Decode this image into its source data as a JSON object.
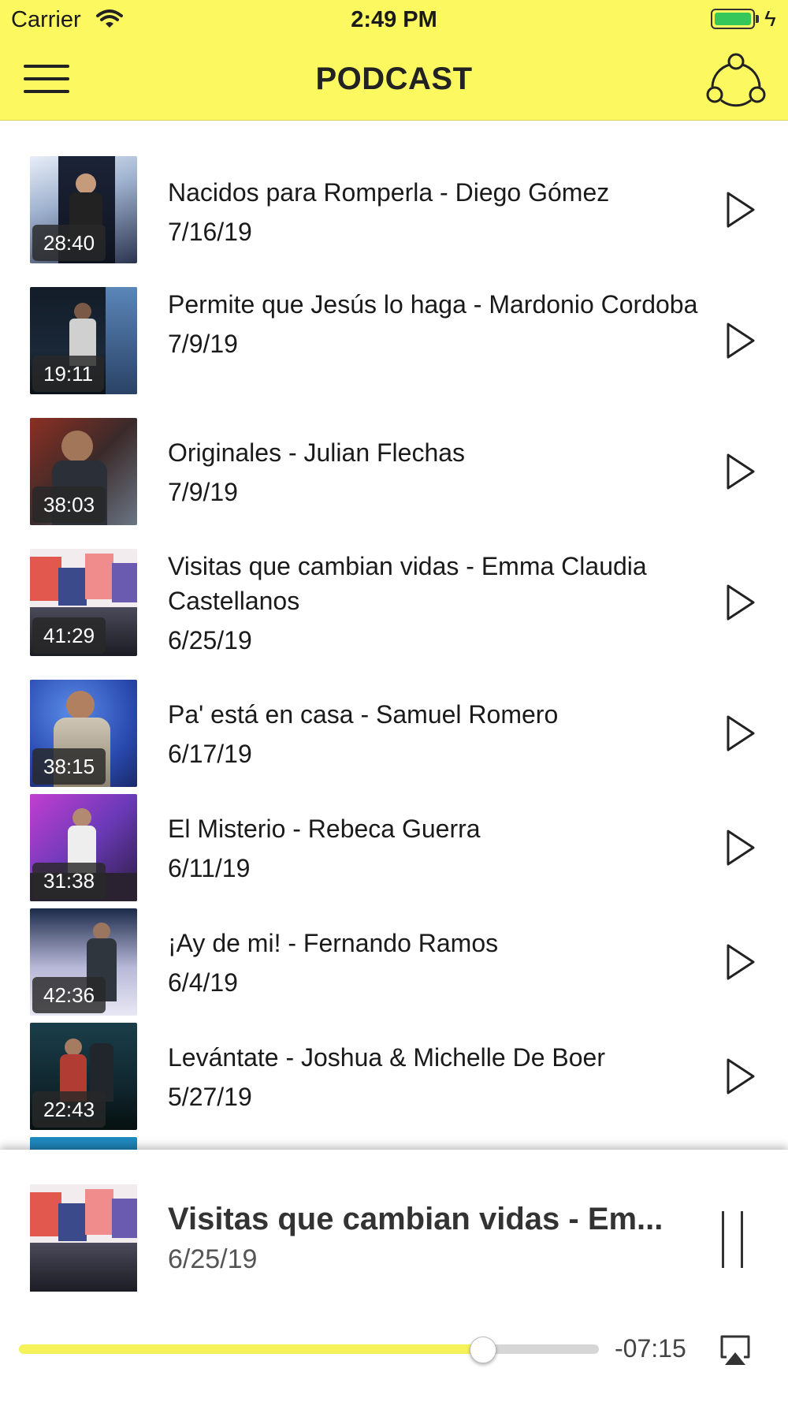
{
  "status": {
    "carrier": "Carrier",
    "time": "2:49 PM"
  },
  "header": {
    "title": "PODCAST"
  },
  "episodes": [
    {
      "title": "Nacidos para Romperla - Diego Gómez",
      "date": "7/16/19",
      "duration": "28:40"
    },
    {
      "title": "Permite que Jesús lo haga - Mardonio Cordoba",
      "date": "7/9/19",
      "duration": "19:11"
    },
    {
      "title": "Originales - Julian Flechas",
      "date": "7/9/19",
      "duration": "38:03"
    },
    {
      "title": "Visitas que cambian vidas - Emma Claudia Castellanos",
      "date": "6/25/19",
      "duration": "41:29"
    },
    {
      "title": "Pa' está en casa - Samuel Romero",
      "date": "6/17/19",
      "duration": "38:15"
    },
    {
      "title": "El Misterio - Rebeca Guerra",
      "date": "6/11/19",
      "duration": "31:38"
    },
    {
      "title": "¡Ay de mi! - Fernando Ramos",
      "date": "6/4/19",
      "duration": "42:36"
    },
    {
      "title": "Levántate - Joshua & Michelle De Boer",
      "date": "5/27/19",
      "duration": "22:43"
    }
  ],
  "player": {
    "title": "Visitas que cambian vidas - Em...",
    "date": "6/25/19",
    "remaining": "-07:15",
    "progress": 0.8
  },
  "colors": {
    "accent": "#fbf95f",
    "progress": "#f6f35a"
  },
  "icons": {
    "menu": "hamburger-icon",
    "share": "share-icon",
    "play": "play-icon",
    "pause": "pause-icon",
    "airplay": "airplay-icon"
  }
}
